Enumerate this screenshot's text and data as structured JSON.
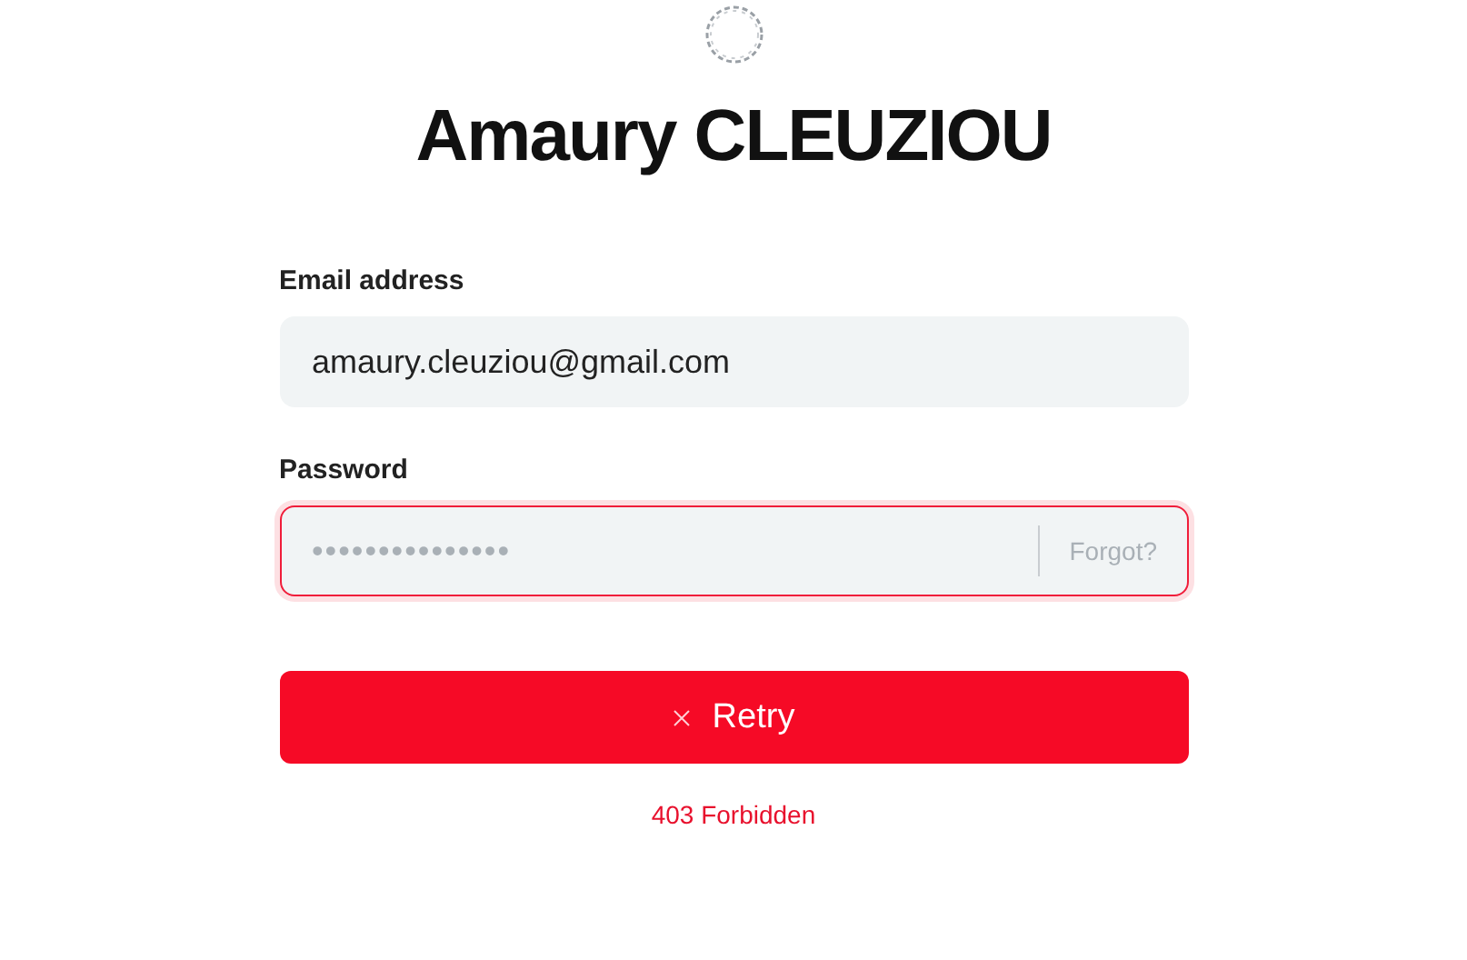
{
  "title": "Amaury CLEUZIOU",
  "fields": [
    {
      "label": "Email address",
      "value": "amaury.cleuziou@gmail.com",
      "error": false
    },
    {
      "label": "Password",
      "placeholder": "•••••••••••••••",
      "link": "Forgot?",
      "error": true
    }
  ],
  "button": {
    "label": "Retry",
    "failed": true
  },
  "message": "403 Forbidden"
}
